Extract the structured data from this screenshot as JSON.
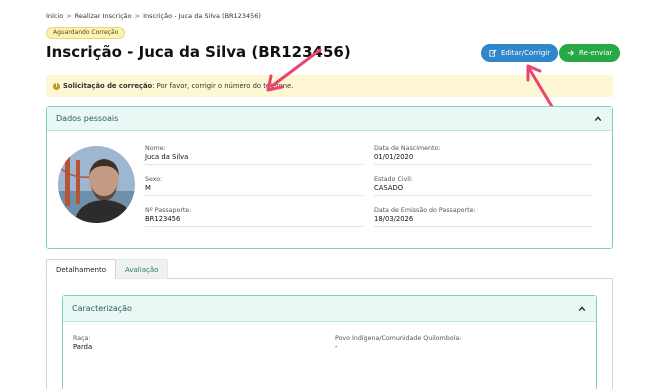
{
  "breadcrumb": {
    "items": [
      "Início",
      "Realizar Inscrição",
      "Inscrição - Juca da Silva (BR123456)"
    ],
    "separator": ">"
  },
  "status": {
    "label": "Aguardando Correção"
  },
  "page": {
    "title": "Inscrição - Juca da Silva (BR123456)"
  },
  "actions": {
    "edit_label": "Editar/Corrigir",
    "resend_label": "Re-enviar"
  },
  "alert": {
    "title": "Solicitação de correção",
    "message": ": Por favor, corrigir o número do telefone."
  },
  "personal": {
    "header": "Dados pessoais",
    "fields": [
      {
        "label": "Nome:",
        "value": "Juca da Silva"
      },
      {
        "label": "Data de Nascimento:",
        "value": "01/01/2020"
      },
      {
        "label": "Sexo:",
        "value": "M"
      },
      {
        "label": "Estado Civil:",
        "value": "CASADO"
      },
      {
        "label": "Nº Passaporte:",
        "value": "BR123456"
      },
      {
        "label": "Data de Emissão do Passaporte:",
        "value": "18/03/2026"
      }
    ]
  },
  "tabs": [
    {
      "label": "Detalhamento",
      "active": true
    },
    {
      "label": "Avaliação",
      "active": false
    }
  ],
  "characterization": {
    "header": "Caracterização",
    "fields": [
      {
        "label": "Raça:",
        "value": "Parda"
      },
      {
        "label": "Povo Indígena/Comunidade Quilombola:",
        "value": "-"
      }
    ]
  },
  "colors": {
    "edit_button": "#2f86c8",
    "resend_button": "#28a745",
    "alert_bg": "#fdf8d3",
    "card_border": "#7fcfc2",
    "annotation_arrow": "#e8466e"
  }
}
